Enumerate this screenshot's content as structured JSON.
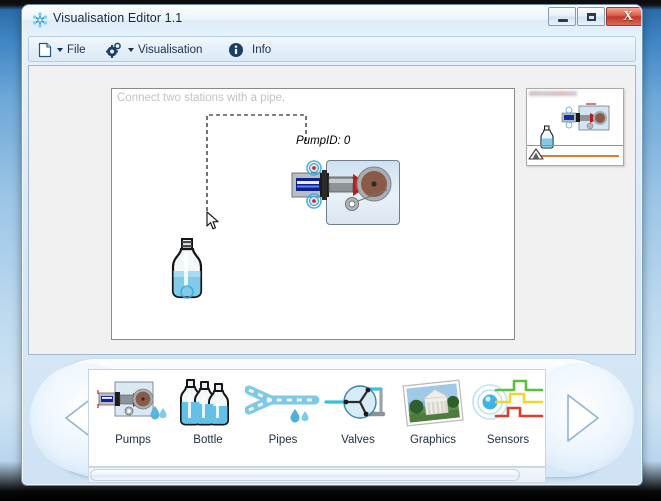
{
  "window": {
    "title": "Visualisation Editor 1.1",
    "app_icon": "snowflake-icon",
    "controls": {
      "minimize": "minimize-button",
      "maximize": "maximize-button",
      "close_glyph": "X"
    }
  },
  "toolbar": {
    "items": [
      {
        "label": "File",
        "icon": "document-icon",
        "has_caret": true
      },
      {
        "label": "Visualisation",
        "icon": "gear-icon",
        "has_caret": true
      },
      {
        "label": "Info",
        "icon": "info-icon",
        "has_caret": false
      }
    ]
  },
  "canvas": {
    "hint": "Connect two stations with a pipe,",
    "elements": {
      "pump": {
        "label": "PumpID: 0",
        "type": "pump-station"
      },
      "bottle": {
        "type": "bottle-station"
      }
    },
    "cursor": "mouse-pointer"
  },
  "minimap": {
    "title": "overview-thumbnail"
  },
  "palette": {
    "nav_left": "previous-page-arrow",
    "nav_right": "next-page-arrow",
    "items": [
      {
        "label": "Pumps",
        "icon": "pump-icon"
      },
      {
        "label": "Bottle",
        "icon": "bottles-icon"
      },
      {
        "label": "Pipes",
        "icon": "pipes-icon"
      },
      {
        "label": "Valves",
        "icon": "valve-icon"
      },
      {
        "label": "Graphics",
        "icon": "photo-icon"
      },
      {
        "label": "Sensors",
        "icon": "sensor-icon"
      }
    ]
  },
  "colors": {
    "accent_orange": "#e07b34",
    "title_text": "#13293f",
    "hint_text": "#c2c2c2",
    "close_button": "#c0392b"
  }
}
